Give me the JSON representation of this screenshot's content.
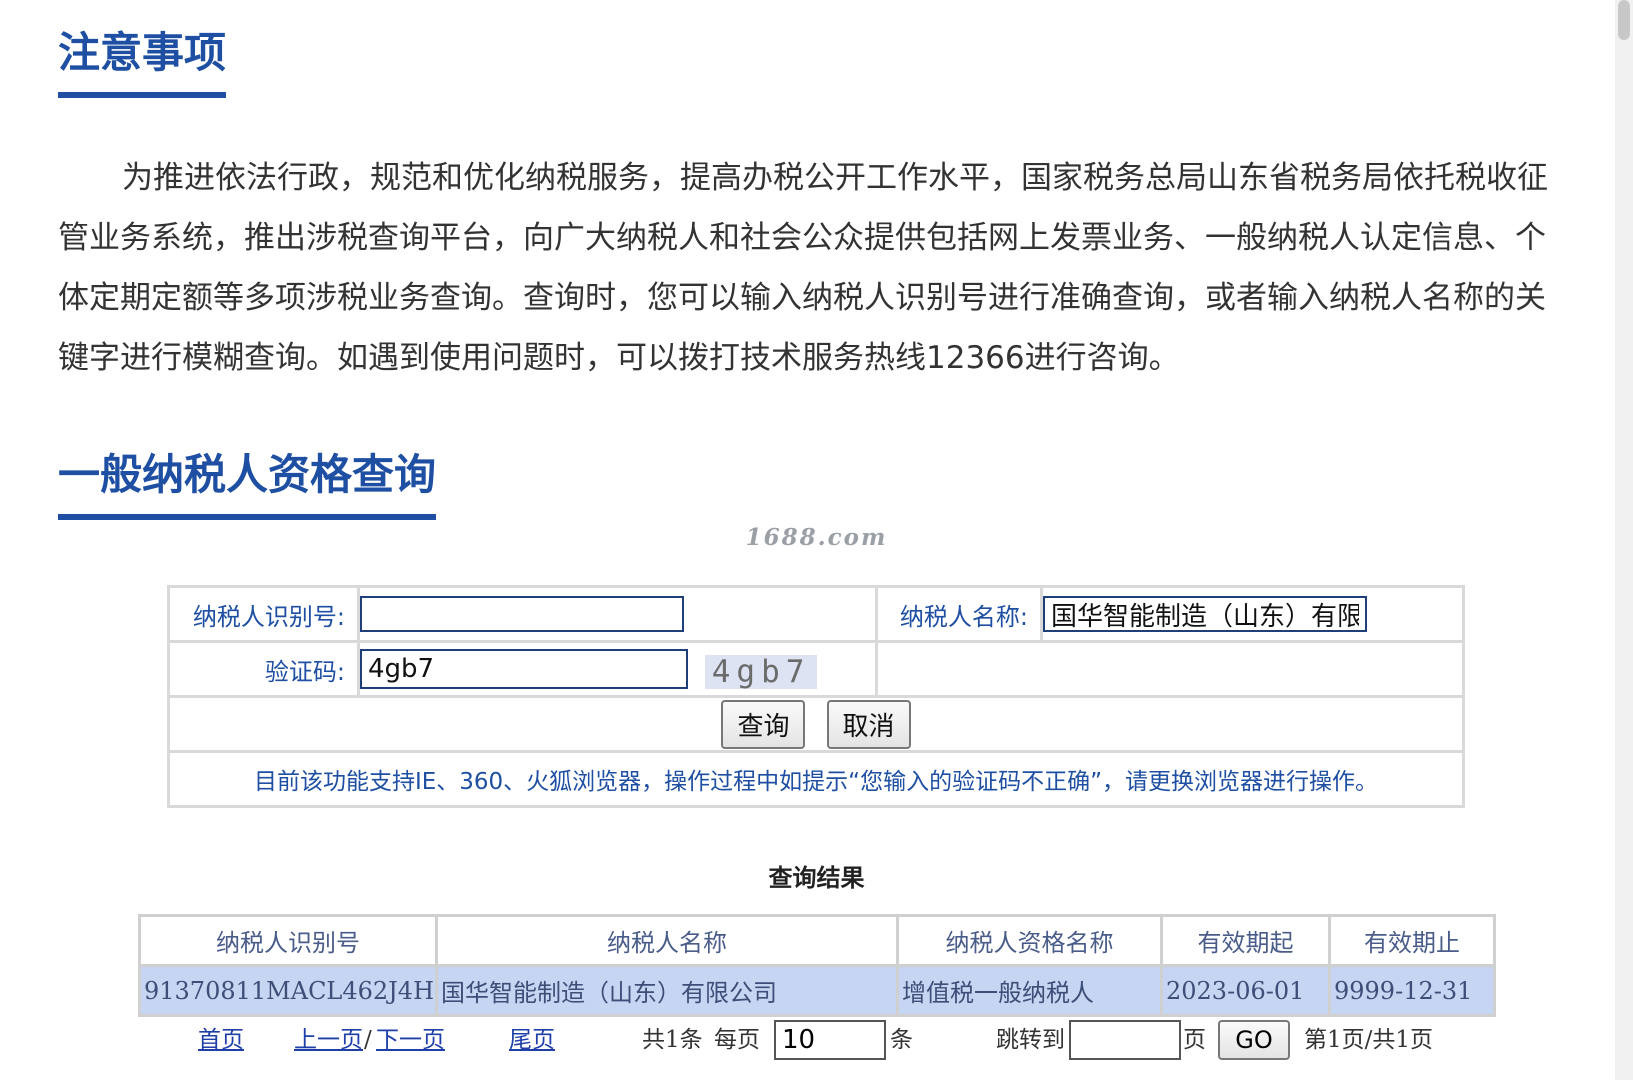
{
  "notice": {
    "title": "注意事项",
    "text": "为推进依法行政，规范和优化纳税服务，提高办税公开工作水平，国家税务总局山东省税务局依托税收征管业务系统，推出涉税查询平台，向广大纳税人和社会公众提供包括网上发票业务、一般纳税人认定信息、个体定期定额等多项涉税业务查询。查询时，您可以输入纳税人识别号进行准确查询，或者输入纳税人名称的关键字进行模糊查询。如遇到使用问题时，可以拨打技术服务热线12366进行咨询。"
  },
  "query": {
    "title": "一般纳税人资格查询",
    "watermark": "1688.com",
    "taxpayer_id_label": "纳税人识别号:",
    "taxpayer_id_value": "",
    "taxpayer_name_label": "纳税人名称:",
    "taxpayer_name_value": "国华智能制造（山东）有限公司",
    "captcha_label": "验证码:",
    "captcha_value": "4gb7",
    "captcha_image_text": "4gb7",
    "submit_label": "查询",
    "cancel_label": "取消",
    "hint": "目前该功能支持IE、360、火狐浏览器，操作过程中如提示“您输入的验证码不正确”，请更换浏览器进行操作。"
  },
  "results": {
    "title": "查询结果",
    "columns": [
      "纳税人识别号",
      "纳税人名称",
      "纳税人资格名称",
      "有效期起",
      "有效期止"
    ],
    "rows": [
      [
        "91370811MACL462J4H",
        "国华智能制造（山东）有限公司",
        "增值税一般纳税人",
        "2023-06-01",
        "9999-12-31"
      ]
    ]
  },
  "pager": {
    "first": "首页",
    "prev": "上一页",
    "slash": "/",
    "next": "下一页",
    "last": "尾页",
    "total": "共1条",
    "per_page_label": "每页",
    "per_page_value": "10",
    "per_page_unit": "条",
    "jump_label": "跳转到",
    "jump_value": "",
    "page_unit": "页",
    "go_label": "GO",
    "status": "第1页/共1页"
  },
  "colors": {
    "accent": "#1e4fa3",
    "row_highlight": "#c6d5f2",
    "link": "#1e3fa8"
  }
}
